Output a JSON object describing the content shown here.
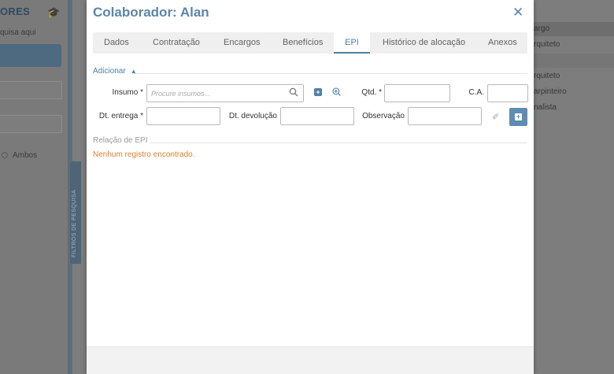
{
  "background": {
    "title": "ORES",
    "search_hint": "quisa aqui",
    "radio_label": "Ambos",
    "side_tab_label": "FILTROS DE PESQUISA",
    "right_header": "argo",
    "right_rows": [
      "rquiteto",
      "rquiteto",
      "arpinteiro",
      "nalista"
    ]
  },
  "modal": {
    "title": "Colaborador: Alan",
    "close_label": "✕",
    "tabs": [
      "Dados",
      "Contratação",
      "Encargos",
      "Benefícios",
      "EPI",
      "Histórico de alocação",
      "Anexos"
    ],
    "active_tab": "EPI",
    "add_section": {
      "label": "Adicionar",
      "toggle_icon": "chevron-up-icon"
    },
    "form": {
      "insumo_label": "Insumo *",
      "insumo_placeholder": "Procure insumos...",
      "qtd_label": "Qtd. *",
      "ca_label": "C.A.",
      "dt_entrega_label": "Dt. entrega *",
      "dt_devolucao_label": "Dt. devolução",
      "observacao_label": "Observação"
    },
    "list_section": {
      "label": "Relação de EPI",
      "empty_message": "Nenhum registro encontrado."
    }
  },
  "colors": {
    "accent": "#4e7fa3",
    "warning": "#d9812f",
    "overlay": "#7d7d7d"
  }
}
